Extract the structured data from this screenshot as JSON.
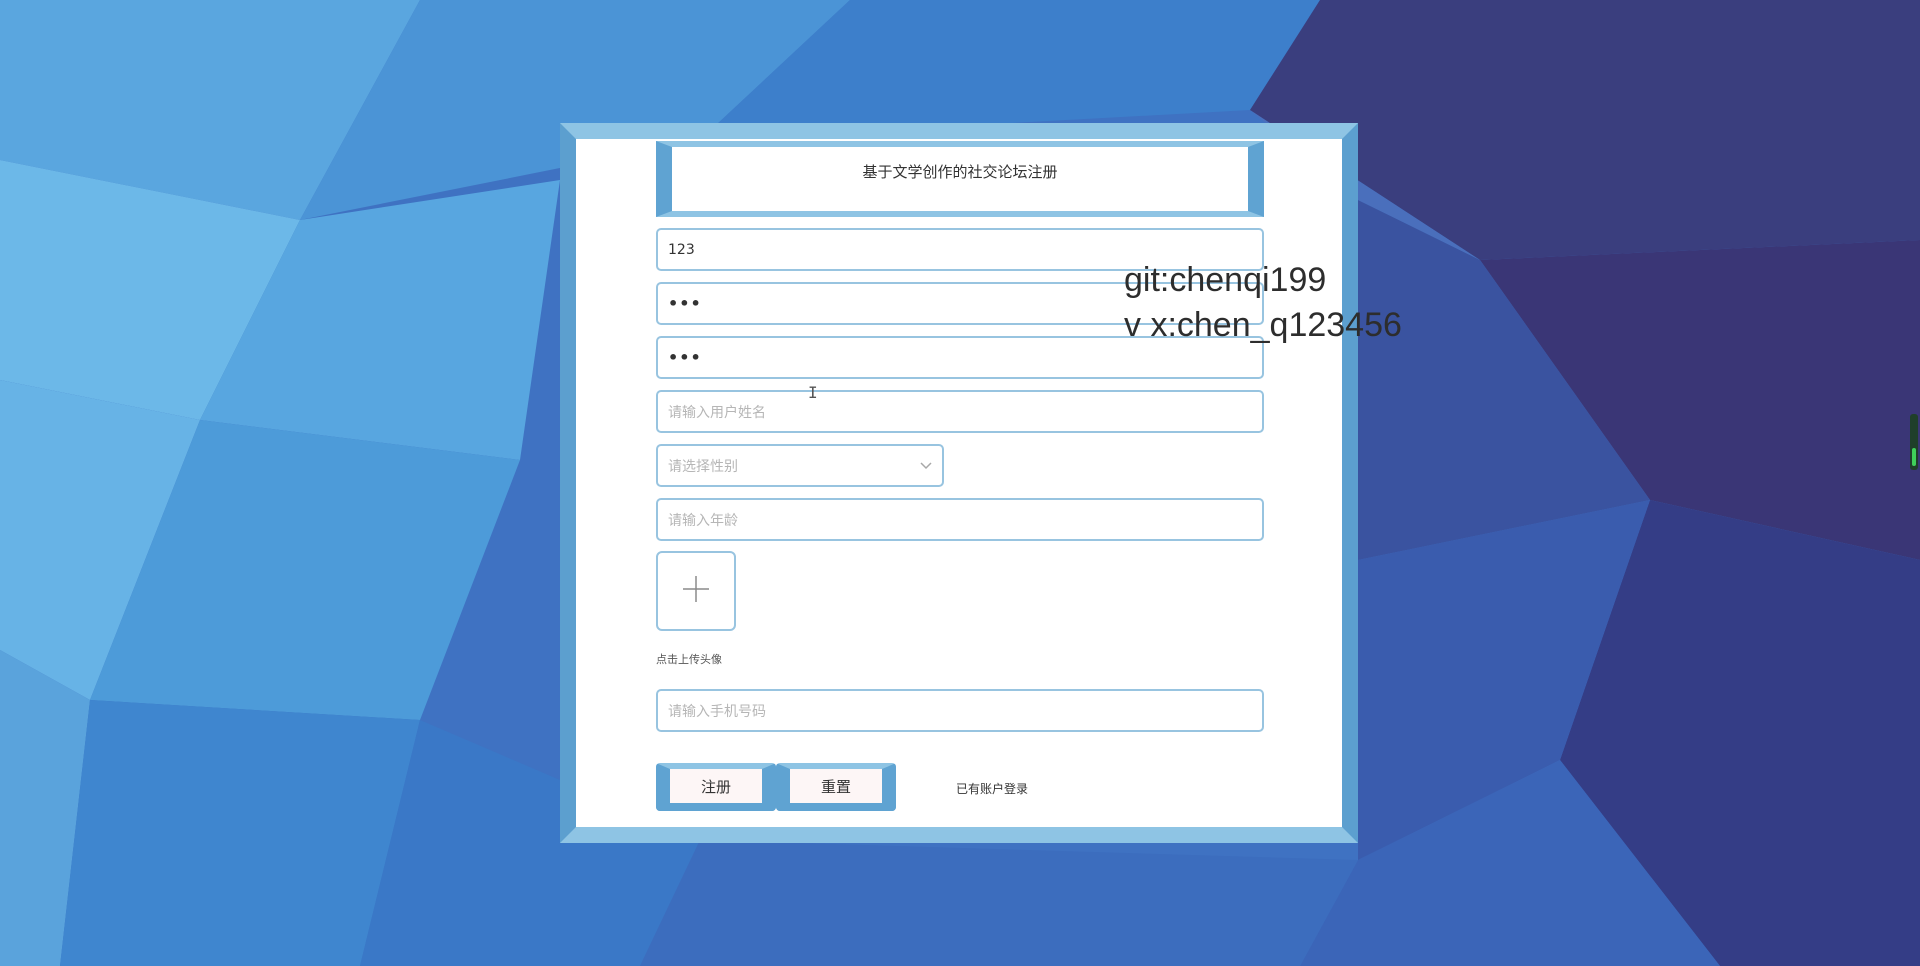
{
  "form": {
    "title": "基于文学创作的社交论坛注册",
    "username_value": "123",
    "password_value": "•••",
    "confirm_password_value": "•••",
    "realname_placeholder": "请输入用户姓名",
    "gender_placeholder": "请选择性别",
    "age_placeholder": "请输入年龄",
    "upload_hint": "点击上传头像",
    "phone_placeholder": "请输入手机号码",
    "register_label": "注册",
    "reset_label": "重置",
    "login_link": "已有账户登录"
  },
  "watermark": {
    "line1": "git:chenqi199",
    "line2": "v x:chen_q123456"
  },
  "colors": {
    "frame": "#6eaed6",
    "input_border": "#98c4e0",
    "button_face": "#fdf6f6"
  }
}
